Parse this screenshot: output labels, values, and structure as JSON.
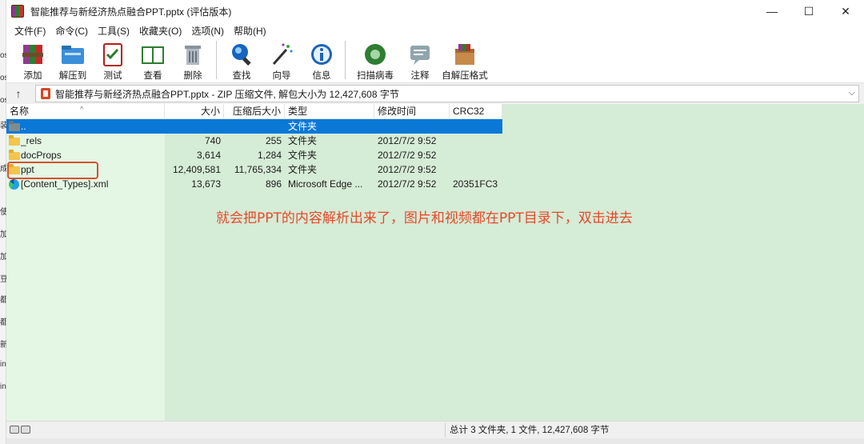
{
  "window": {
    "title": "智能推荐与新经济热点融合PPT.pptx (评估版本)",
    "minimize": "—",
    "maximize": "☐",
    "close": "✕"
  },
  "menu": [
    "文件(F)",
    "命令(C)",
    "工具(S)",
    "收藏夹(O)",
    "选项(N)",
    "帮助(H)"
  ],
  "toolbar": [
    {
      "label": "添加",
      "icon": "add-archive-icon"
    },
    {
      "label": "解压到",
      "icon": "extract-to-icon"
    },
    {
      "label": "测试",
      "icon": "test-icon"
    },
    {
      "label": "查看",
      "icon": "view-icon"
    },
    {
      "label": "删除",
      "icon": "delete-icon"
    },
    {
      "label": "查找",
      "icon": "find-icon"
    },
    {
      "label": "向导",
      "icon": "wizard-icon"
    },
    {
      "label": "信息",
      "icon": "info-icon"
    },
    {
      "label": "扫描病毒",
      "icon": "virus-scan-icon"
    },
    {
      "label": "注释",
      "icon": "comment-icon"
    },
    {
      "label": "自解压格式",
      "icon": "sfx-icon"
    }
  ],
  "address": {
    "up": "↑",
    "path": "智能推荐与新经济热点融合PPT.pptx - ZIP 压缩文件, 解包大小为 12,427,608 字节",
    "dropdown": "⌵"
  },
  "columns": {
    "name": "名称",
    "size": "大小",
    "packed": "压缩后大小",
    "type": "类型",
    "modified": "修改时间",
    "crc": "CRC32",
    "sort_caret": "^"
  },
  "rows": [
    {
      "name": "..",
      "size": "",
      "packed": "",
      "type": "文件夹",
      "modified": "",
      "crc": "",
      "icon": "parent-folder-icon",
      "selected": true
    },
    {
      "name": "_rels",
      "size": "740",
      "packed": "255",
      "type": "文件夹",
      "modified": "2012/7/2 9:52",
      "crc": "",
      "icon": "folder-icon"
    },
    {
      "name": "docProps",
      "size": "3,614",
      "packed": "1,284",
      "type": "文件夹",
      "modified": "2012/7/2 9:52",
      "crc": "",
      "icon": "folder-icon"
    },
    {
      "name": "ppt",
      "size": "12,409,581",
      "packed": "11,765,334",
      "type": "文件夹",
      "modified": "2012/7/2 9:52",
      "crc": "",
      "icon": "folder-icon"
    },
    {
      "name": "[Content_Types].xml",
      "size": "13,673",
      "packed": "896",
      "type": "Microsoft Edge ...",
      "modified": "2012/7/2 9:52",
      "crc": "20351FC3",
      "icon": "edge-file-icon"
    }
  ],
  "annotation": "就会把PPT的内容解析出来了，图片和视频都在PPT目录下，双击进去",
  "status": "总计 3 文件夹, 1 文件, 12,427,608 字节",
  "background_strip": [
    "os",
    "os",
    "os",
    "装",
    "成",
    "使",
    "加",
    "加",
    "豆",
    "都",
    "都",
    "新",
    "in",
    "in"
  ],
  "colors": {
    "selection": "#0a78d7",
    "annotation": "#e8492a",
    "highlight_box": "#d9512c",
    "list_bg": "#d5ecd6"
  }
}
